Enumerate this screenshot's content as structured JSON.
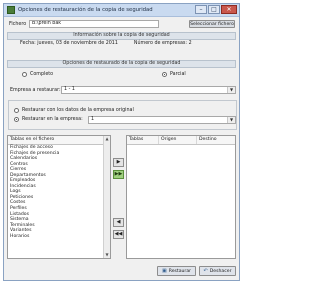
{
  "window": {
    "title": "Opciones de restauración de la copia de seguridad"
  },
  "file": {
    "label": "Fichero",
    "value": "B:\\prein bak",
    "button": "Seleccionar fichero"
  },
  "backup_info": {
    "header": "Información sobre la copia de seguridad",
    "date": "Fecha: jueves, 03 de noviembre de 2011",
    "companies": "Número de empresas: 2"
  },
  "restore_mode": {
    "header": "Opciones de restaurado de la copia de seguridad",
    "complete": "Completo",
    "partial": "Parcial",
    "selected": "partial"
  },
  "company": {
    "label": "Empresa a restaurar:",
    "value": "1 - 1"
  },
  "target": {
    "option_original": "Restaurar con los datos de la empresa original",
    "option_company": "Restaurar en la empresa:",
    "company_value": "1",
    "selected": "company"
  },
  "tables": {
    "header": "Tablas en el fichero",
    "items": [
      "Fichajes de acceso",
      "Fichajes de presencia",
      "Calendarios",
      "Centros",
      "Cierres",
      "Departamentos",
      "Empleados",
      "Incidencias",
      "Logs",
      "Peticiones",
      "Costes",
      "Perfiles",
      "Listados",
      "Sistema",
      "Terminales",
      "Variantes",
      "Horarios"
    ]
  },
  "selected_grid": {
    "columns": [
      "Tablas",
      "Origen",
      "Destino"
    ]
  },
  "move_buttons": {
    "add": "▶",
    "add_all": "▶▶",
    "remove": "◀",
    "remove_all": "◀◀"
  },
  "footer": {
    "restore": "Restaurar",
    "undo": "Deshacer"
  }
}
